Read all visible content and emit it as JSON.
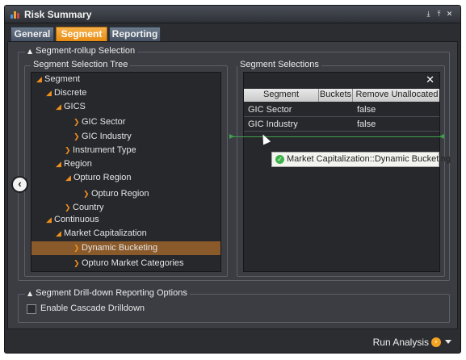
{
  "window": {
    "title": "Risk Summary",
    "title_icon": "bar-chart-icon",
    "buttons": [
      "download-icon",
      "export-icon",
      "close-icon"
    ]
  },
  "tabs": [
    {
      "label": "General",
      "active": false
    },
    {
      "label": "Segment",
      "active": true
    },
    {
      "label": "Reporting",
      "active": false
    }
  ],
  "rollup": {
    "legend": "Segment-rollup Selection",
    "tree_legend": "Segment Selection Tree",
    "tree": [
      {
        "label": "Segment",
        "expanded": true
      },
      {
        "label": "Discrete",
        "expanded": true
      },
      {
        "label": "GICS",
        "expanded": true
      },
      {
        "label": "GIC Sector",
        "expanded": false
      },
      {
        "label": "GIC Industry",
        "expanded": false
      },
      {
        "label": "Instrument Type",
        "expanded": false
      },
      {
        "label": "Region",
        "expanded": true
      },
      {
        "label": "Opturo Region",
        "expanded": true
      },
      {
        "label": "Opturo Region",
        "expanded": false
      },
      {
        "label": "Country",
        "expanded": false
      },
      {
        "label": "Continuous",
        "expanded": true
      },
      {
        "label": "Market Capitalization",
        "expanded": true
      },
      {
        "label": "Dynamic Bucketing",
        "expanded": false,
        "selected": true
      },
      {
        "label": "Opturo Market Categories",
        "expanded": false
      }
    ],
    "selections_legend": "Segment Selections",
    "grid_columns": [
      "Segment",
      "Buckets",
      "Remove Unallocated"
    ],
    "grid_rows": [
      {
        "segment": "GIC Sector",
        "buckets": "",
        "remove": "false"
      },
      {
        "segment": "GIC Industry",
        "buckets": "",
        "remove": "false"
      }
    ],
    "drag_tooltip": "Market Capitalization::Dynamic Bucketing"
  },
  "drilldown": {
    "legend": "Segment Drill-down Reporting Options",
    "cascade_label": "Enable Cascade Drilldown",
    "cascade_checked": false
  },
  "footer": {
    "run_label": "Run Analysis"
  },
  "colors": {
    "accent": "#f18f1c",
    "selected_row": "#8a5a2a",
    "drop_line": "#3fa14a"
  }
}
